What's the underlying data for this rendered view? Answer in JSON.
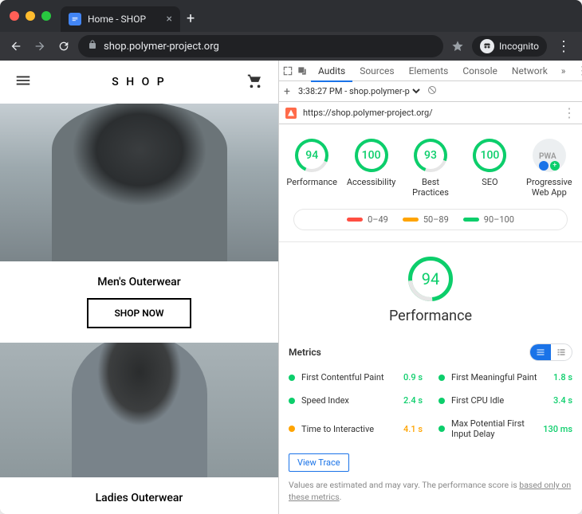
{
  "browser": {
    "tab_title": "Home - SHOP",
    "url_display": "shop.polymer-project.org",
    "incognito_label": "Incognito"
  },
  "site": {
    "logo": "S H O P",
    "section1_title": "Men's Outerwear",
    "shop_now": "SHOP NOW",
    "section2_title": "Ladies Outerwear"
  },
  "devtools": {
    "tabs": [
      "Audits",
      "Sources",
      "Elements",
      "Console",
      "Network"
    ],
    "active_tab": "Audits",
    "more_glyph": "»",
    "sub_selected": "3:38:27 PM - shop.polymer-pr…",
    "audit_url": "https://shop.polymer-project.org/",
    "scores": [
      {
        "label": "Performance",
        "value": "94"
      },
      {
        "label": "Accessibility",
        "value": "100"
      },
      {
        "label": "Best Practices",
        "value": "93"
      },
      {
        "label": "SEO",
        "value": "100"
      }
    ],
    "pwa_label": "Progressive Web App",
    "legend": {
      "bad": "0–49",
      "mid": "50–89",
      "good": "90–100"
    },
    "big_score": {
      "value": "94",
      "label": "Performance"
    },
    "metrics_title": "Metrics",
    "metrics": [
      {
        "name": "First Contentful Paint",
        "value": "0.9 s",
        "status": "g"
      },
      {
        "name": "First Meaningful Paint",
        "value": "1.8 s",
        "status": "g"
      },
      {
        "name": "Speed Index",
        "value": "2.4 s",
        "status": "g"
      },
      {
        "name": "First CPU Idle",
        "value": "3.4 s",
        "status": "g"
      },
      {
        "name": "Time to Interactive",
        "value": "4.1 s",
        "status": "o"
      },
      {
        "name": "Max Potential First Input Delay",
        "value": "130 ms",
        "status": "g"
      }
    ],
    "view_trace": "View Trace",
    "disclaimer_a": "Values are estimated and may vary. The performance score is ",
    "disclaimer_link": "based only on these metrics",
    "disclaimer_b": "."
  }
}
